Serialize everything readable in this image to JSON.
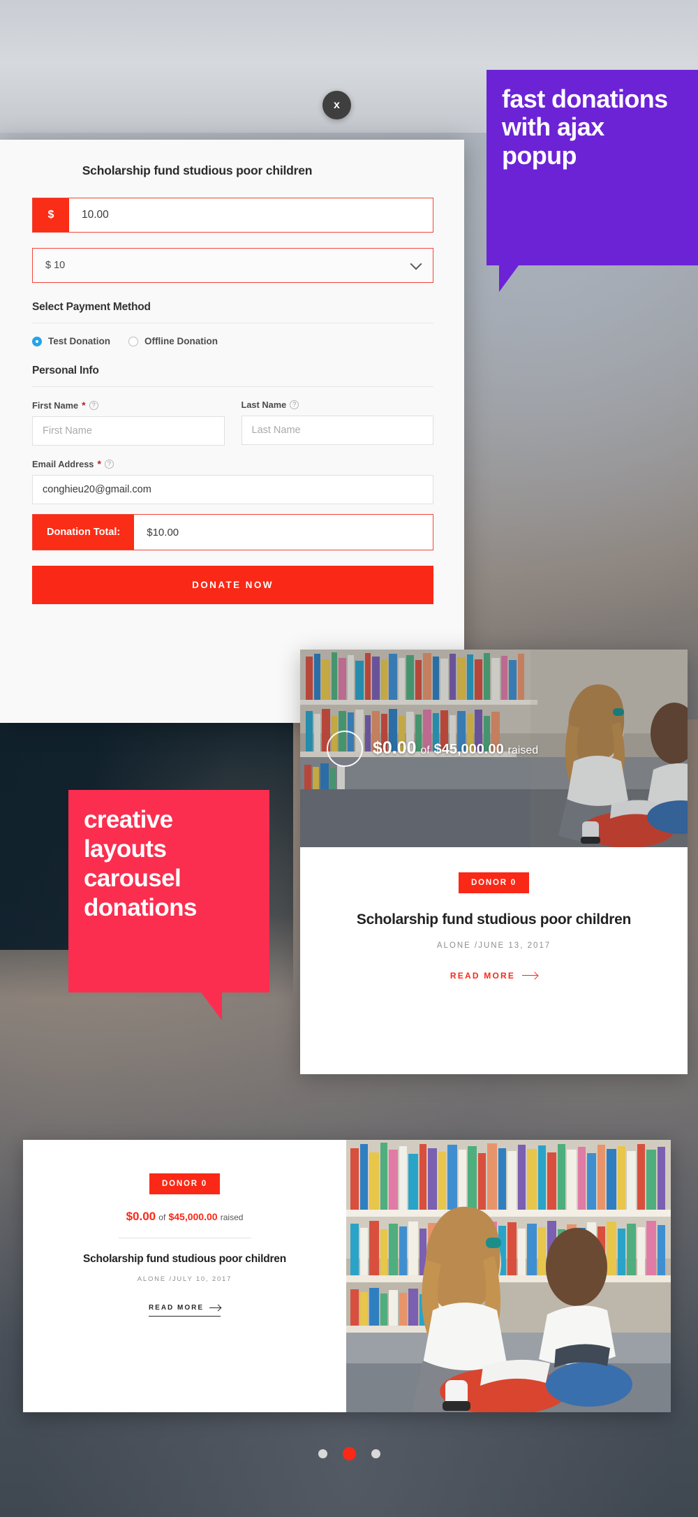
{
  "form": {
    "title": "Scholarship fund studious poor children",
    "currency_symbol": "$",
    "amount_value": "10.00",
    "amount_placeholder": "10.00",
    "donation_level": "$ 10",
    "payment_section_heading": "Select Payment Method",
    "gateways": [
      {
        "label": "Test Donation",
        "selected": true
      },
      {
        "label": "Offline Donation",
        "selected": false
      }
    ],
    "personal_section_heading": "Personal Info",
    "first_name_label": "First Name",
    "first_name_placeholder": "First Name",
    "first_name_value": "",
    "last_name_label": "Last Name",
    "last_name_placeholder": "Last Name",
    "last_name_value": "",
    "email_label": "Email Address",
    "email_placeholder": "Email Address",
    "email_value": "conghieu20@gmail.com",
    "required_mark": "*",
    "help_glyph": "?",
    "total_label": "Donation Total:",
    "total_value": "$10.00",
    "submit_label": "DONATE NOW",
    "close_label": "x",
    "accent_red": "#fa2816",
    "border_red": "#f2443a",
    "radio_blue": "#25a4e8"
  },
  "callouts": [
    {
      "text": "fast donations with ajax popup",
      "color": "#6c23d6"
    },
    {
      "text": "creative layouts carousel donations",
      "color": "#fb2e50"
    }
  ],
  "donation_card": {
    "raised_amount": "$0.00",
    "of_word": "of",
    "goal_amount": "$45,000.00",
    "raised_word": "raised",
    "donor_badge": "DONOR 0",
    "title": "Scholarship fund studious poor children",
    "meta": "ALONE /JUNE 13, 2017",
    "read_more": "READ MORE"
  },
  "carousel_card": {
    "donor_badge": "DONOR 0",
    "raised_amount": "$0.00",
    "of_word": "of",
    "goal_amount": "$45,000.00",
    "raised_word": "raised",
    "title": "Scholarship fund studious poor children",
    "meta": "ALONE /JULY 10, 2017",
    "read_more": "READ MORE"
  },
  "pagination": {
    "dots": 3,
    "active_index": 1
  }
}
